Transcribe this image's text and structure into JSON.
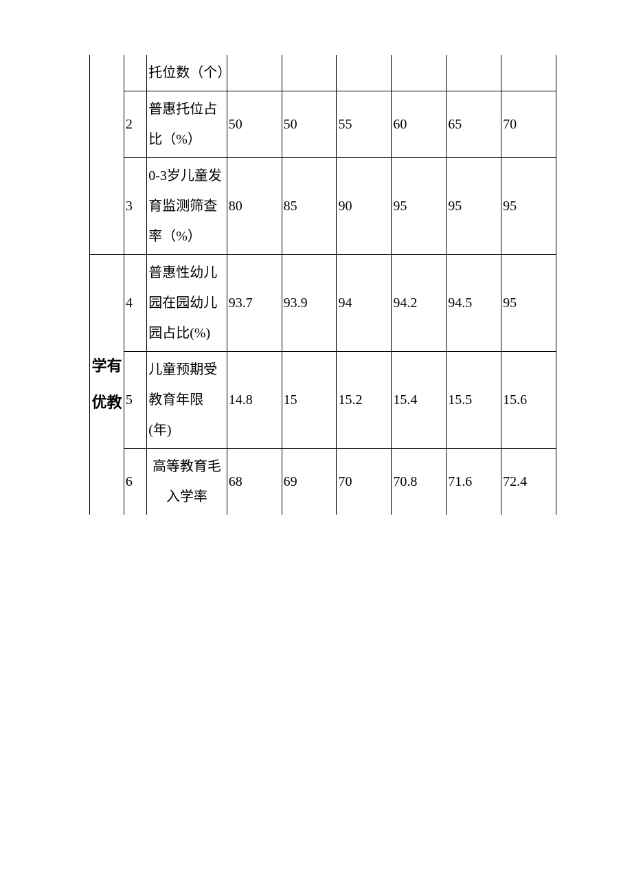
{
  "rows": {
    "r1": {
      "indicator_frag": "托位数（个）"
    },
    "r2": {
      "idx": "2",
      "indicator": "普惠托位占比（%）",
      "v": [
        "50",
        "50",
        "55",
        "60",
        "65",
        "70"
      ]
    },
    "r3": {
      "idx": "3",
      "indicator": "0-3岁儿童发育监测筛查率（%）",
      "v": [
        "80",
        "85",
        "90",
        "95",
        "95",
        "95"
      ]
    },
    "r4": {
      "idx": "4",
      "indicator": "普惠性幼儿园在园幼儿园占比(%)",
      "v": [
        "93.7",
        "93.9",
        "94",
        "94.2",
        "94.5",
        "95"
      ]
    },
    "r5": {
      "idx": "5",
      "indicator": "儿童预期受教育年限(年)",
      "v": [
        "14.8",
        "15",
        "15.2",
        "15.4",
        "15.5",
        "15.6"
      ]
    },
    "r6": {
      "idx": "6",
      "indicator": "高等教育毛入学率",
      "v": [
        "68",
        "69",
        "70",
        "70.8",
        "71.6",
        "72.4"
      ]
    }
  },
  "category2": "学有优教"
}
